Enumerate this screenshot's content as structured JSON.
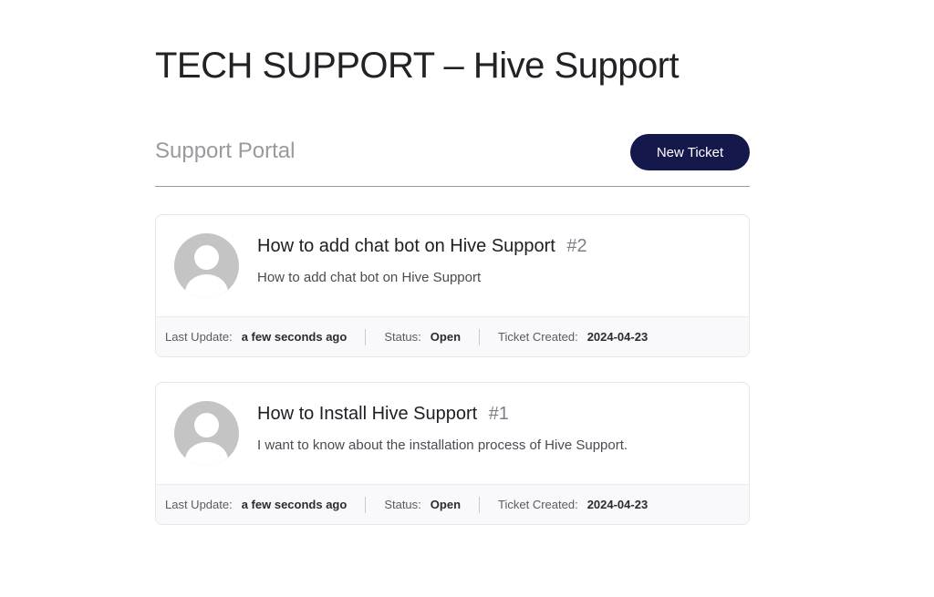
{
  "page": {
    "title": "TECH SUPPORT – Hive Support"
  },
  "portal": {
    "title": "Support Portal",
    "new_ticket_label": "New Ticket"
  },
  "tickets": [
    {
      "title": "How to add chat bot on Hive Support",
      "number": "#2",
      "excerpt": "How to add chat bot on Hive Support",
      "last_update_label": "Last Update:",
      "last_update": "a few seconds ago",
      "status_label": "Status:",
      "status": "Open",
      "created_label": "Ticket Created:",
      "created": "2024-04-23"
    },
    {
      "title": "How to Install Hive Support",
      "number": "#1",
      "excerpt": "I want to know about the installation process of Hive Support.",
      "last_update_label": "Last Update:",
      "last_update": "a few seconds ago",
      "status_label": "Status:",
      "status": "Open",
      "created_label": "Ticket Created:",
      "created": "2024-04-23"
    }
  ],
  "colors": {
    "button_bg": "#15184a",
    "muted_heading": "#9a9a9e",
    "meta_bg": "#f9f9fc",
    "avatar": "#c4c4c4"
  },
  "icons": {
    "avatar": "default-user-avatar-icon"
  }
}
